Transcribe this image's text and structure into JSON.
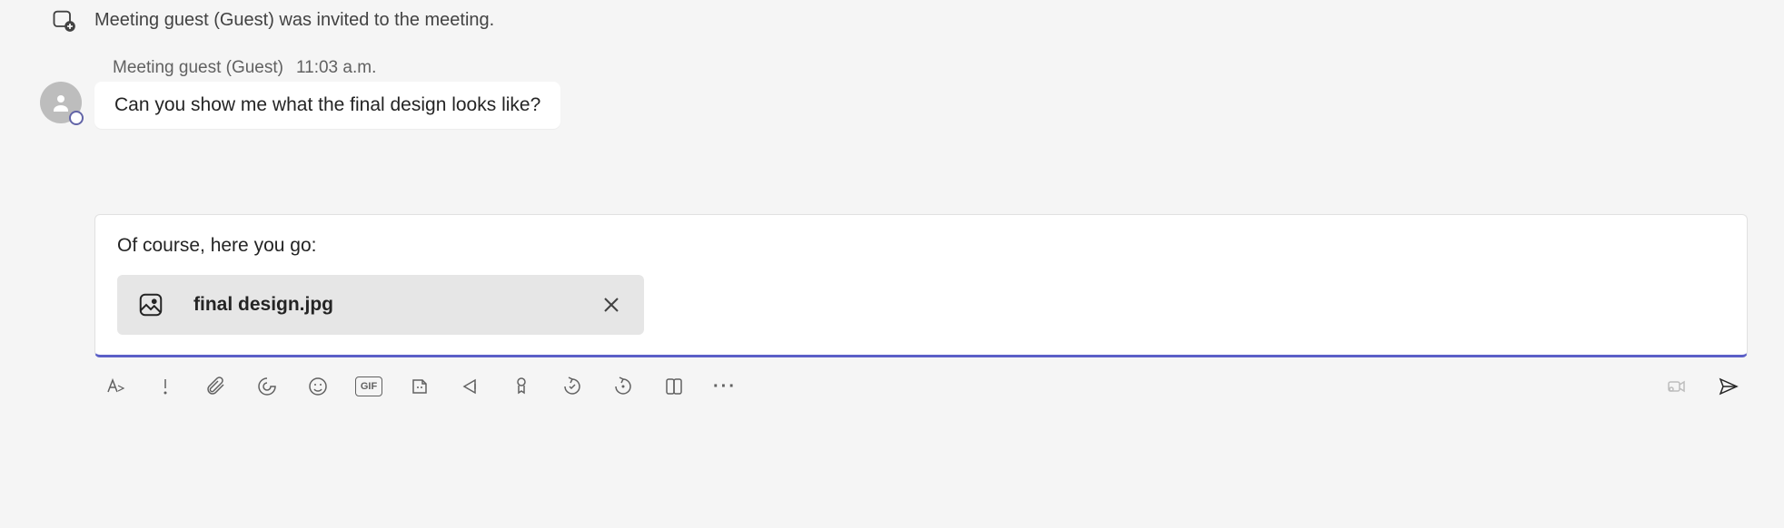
{
  "system_event": {
    "text": "Meeting guest (Guest) was invited to the meeting."
  },
  "message": {
    "sender": "Meeting guest (Guest)",
    "time": "11:03 a.m.",
    "body": "Can you show me what the final design looks like?"
  },
  "composer": {
    "text": "Of course, here you go:",
    "attachment": {
      "filename": "final design.jpg"
    }
  },
  "toolbar": {
    "gif_label": "GIF",
    "more_label": "···"
  }
}
